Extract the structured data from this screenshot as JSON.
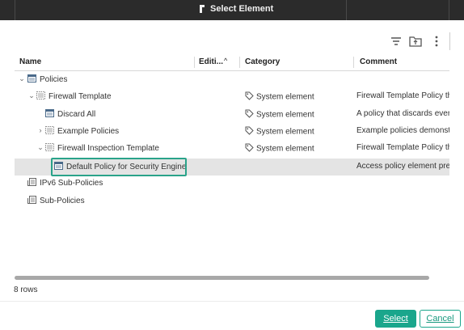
{
  "window": {
    "title": "Select Element"
  },
  "toolbar": {
    "filter_icon": "filter-icon",
    "folder_icon": "folder-icon",
    "more_icon": "more-vertical-icon"
  },
  "table": {
    "headers": {
      "name": "Name",
      "editing": "Editi...",
      "category": "Category",
      "comment": "Comment"
    },
    "sort": "ascending",
    "rows": [
      {
        "name": "Policies",
        "category": "",
        "comment": "",
        "expanded": true,
        "selected": false
      },
      {
        "name": "Firewall Template",
        "category": "System element",
        "comment": "Firewall Template Policy tha",
        "expanded": true,
        "selected": false
      },
      {
        "name": "Discard All",
        "category": "System element",
        "comment": "A policy that discards every",
        "selected": false
      },
      {
        "name": "Example Policies",
        "category": "System element",
        "comment": "Example policies demonstra",
        "expanded": false,
        "selected": false
      },
      {
        "name": "Firewall Inspection Template",
        "category": "System element",
        "comment": "Firewall Template Policy tha",
        "expanded": true,
        "selected": false
      },
      {
        "name": "Default Policy for Security Engine",
        "category": "",
        "comment": "Access policy element pre-",
        "selected": true
      },
      {
        "name": "IPv6 Sub-Policies",
        "category": "",
        "comment": "",
        "selected": false
      },
      {
        "name": "Sub-Policies",
        "category": "",
        "comment": "",
        "selected": false
      }
    ]
  },
  "status": {
    "rows_count": "8 rows"
  },
  "buttons": {
    "select": "Select",
    "cancel": "Cancel"
  },
  "colors": {
    "accent": "#1aa68c",
    "titlebar": "#2b2b2b",
    "selected_row": "#e4e4e4"
  }
}
